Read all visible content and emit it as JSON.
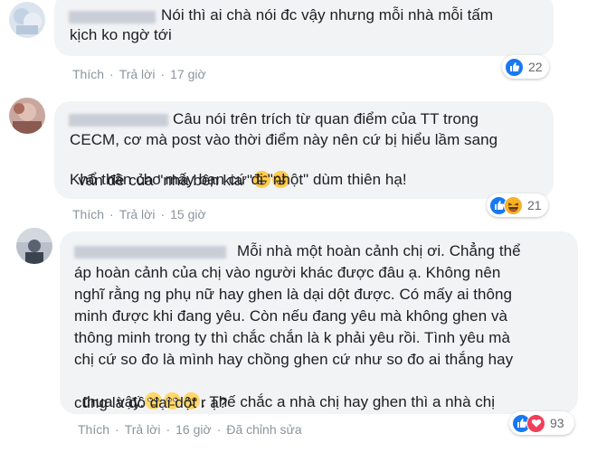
{
  "comments": [
    {
      "lines": [
        "Nói thì ai chà nói đc vậy nhưng mỗi nhà mỗi tấm",
        "kịch ko ngờ tới"
      ],
      "actions": {
        "like": "Thích",
        "reply": "Trả lời",
        "time": "17 giờ"
      },
      "reactions": {
        "icons": [
          "like-icon"
        ],
        "count": "22"
      }
    },
    {
      "lines": [
        "Câu nói trên trích từ quan điểm của TT trong",
        "CECM, cơ mà post vào thời điểm này nên cứ bị hiểu lầm sang",
        "vấn đề của \"nhà bên kia \"",
        "Khổ thân cho mấy bạn cứ đi \"nhột\" dùm thiên hạ!"
      ],
      "actions": {
        "like": "Thích",
        "reply": "Trả lời",
        "time": "15 giờ"
      },
      "reactions": {
        "icons": [
          "like-icon",
          "haha-icon"
        ],
        "count": "21"
      }
    },
    {
      "lines": [
        "Mỗi nhà một hoàn cảnh chị ơi. Chẳng thể",
        "áp hoàn cảnh của chị vào người khác được đâu ạ. Không nên",
        "nghĩ rằng ng phụ nữ hay ghen là dại dột được. Có mấy ai thông",
        "minh được khi đang yêu. Còn nếu đang yêu mà không ghen và",
        "thông minh trong ty thì chắc chắn là k phải yêu rồi. Tình yêu mà",
        "chị cứ so đo là mình hay chồng ghen cứ như so đo ai thắng hay",
        "thua vậy.",
        ". Thế chắc a nhà chị hay ghen thì a nhà chị",
        "cũng là đồ dại dột r ạ?"
      ],
      "actions": {
        "like": "Thích",
        "reply": "Trả lời",
        "time": "16 giờ",
        "edited": "Đã chỉnh sửa"
      },
      "reactions": {
        "icons": [
          "like-icon",
          "love-icon"
        ],
        "count": "93"
      }
    }
  ],
  "colors": {
    "like": "#1878f3",
    "love": "#f33e58",
    "haha": "#f7b125",
    "meta": "#8d949e",
    "bubble": "#f2f3f5"
  }
}
